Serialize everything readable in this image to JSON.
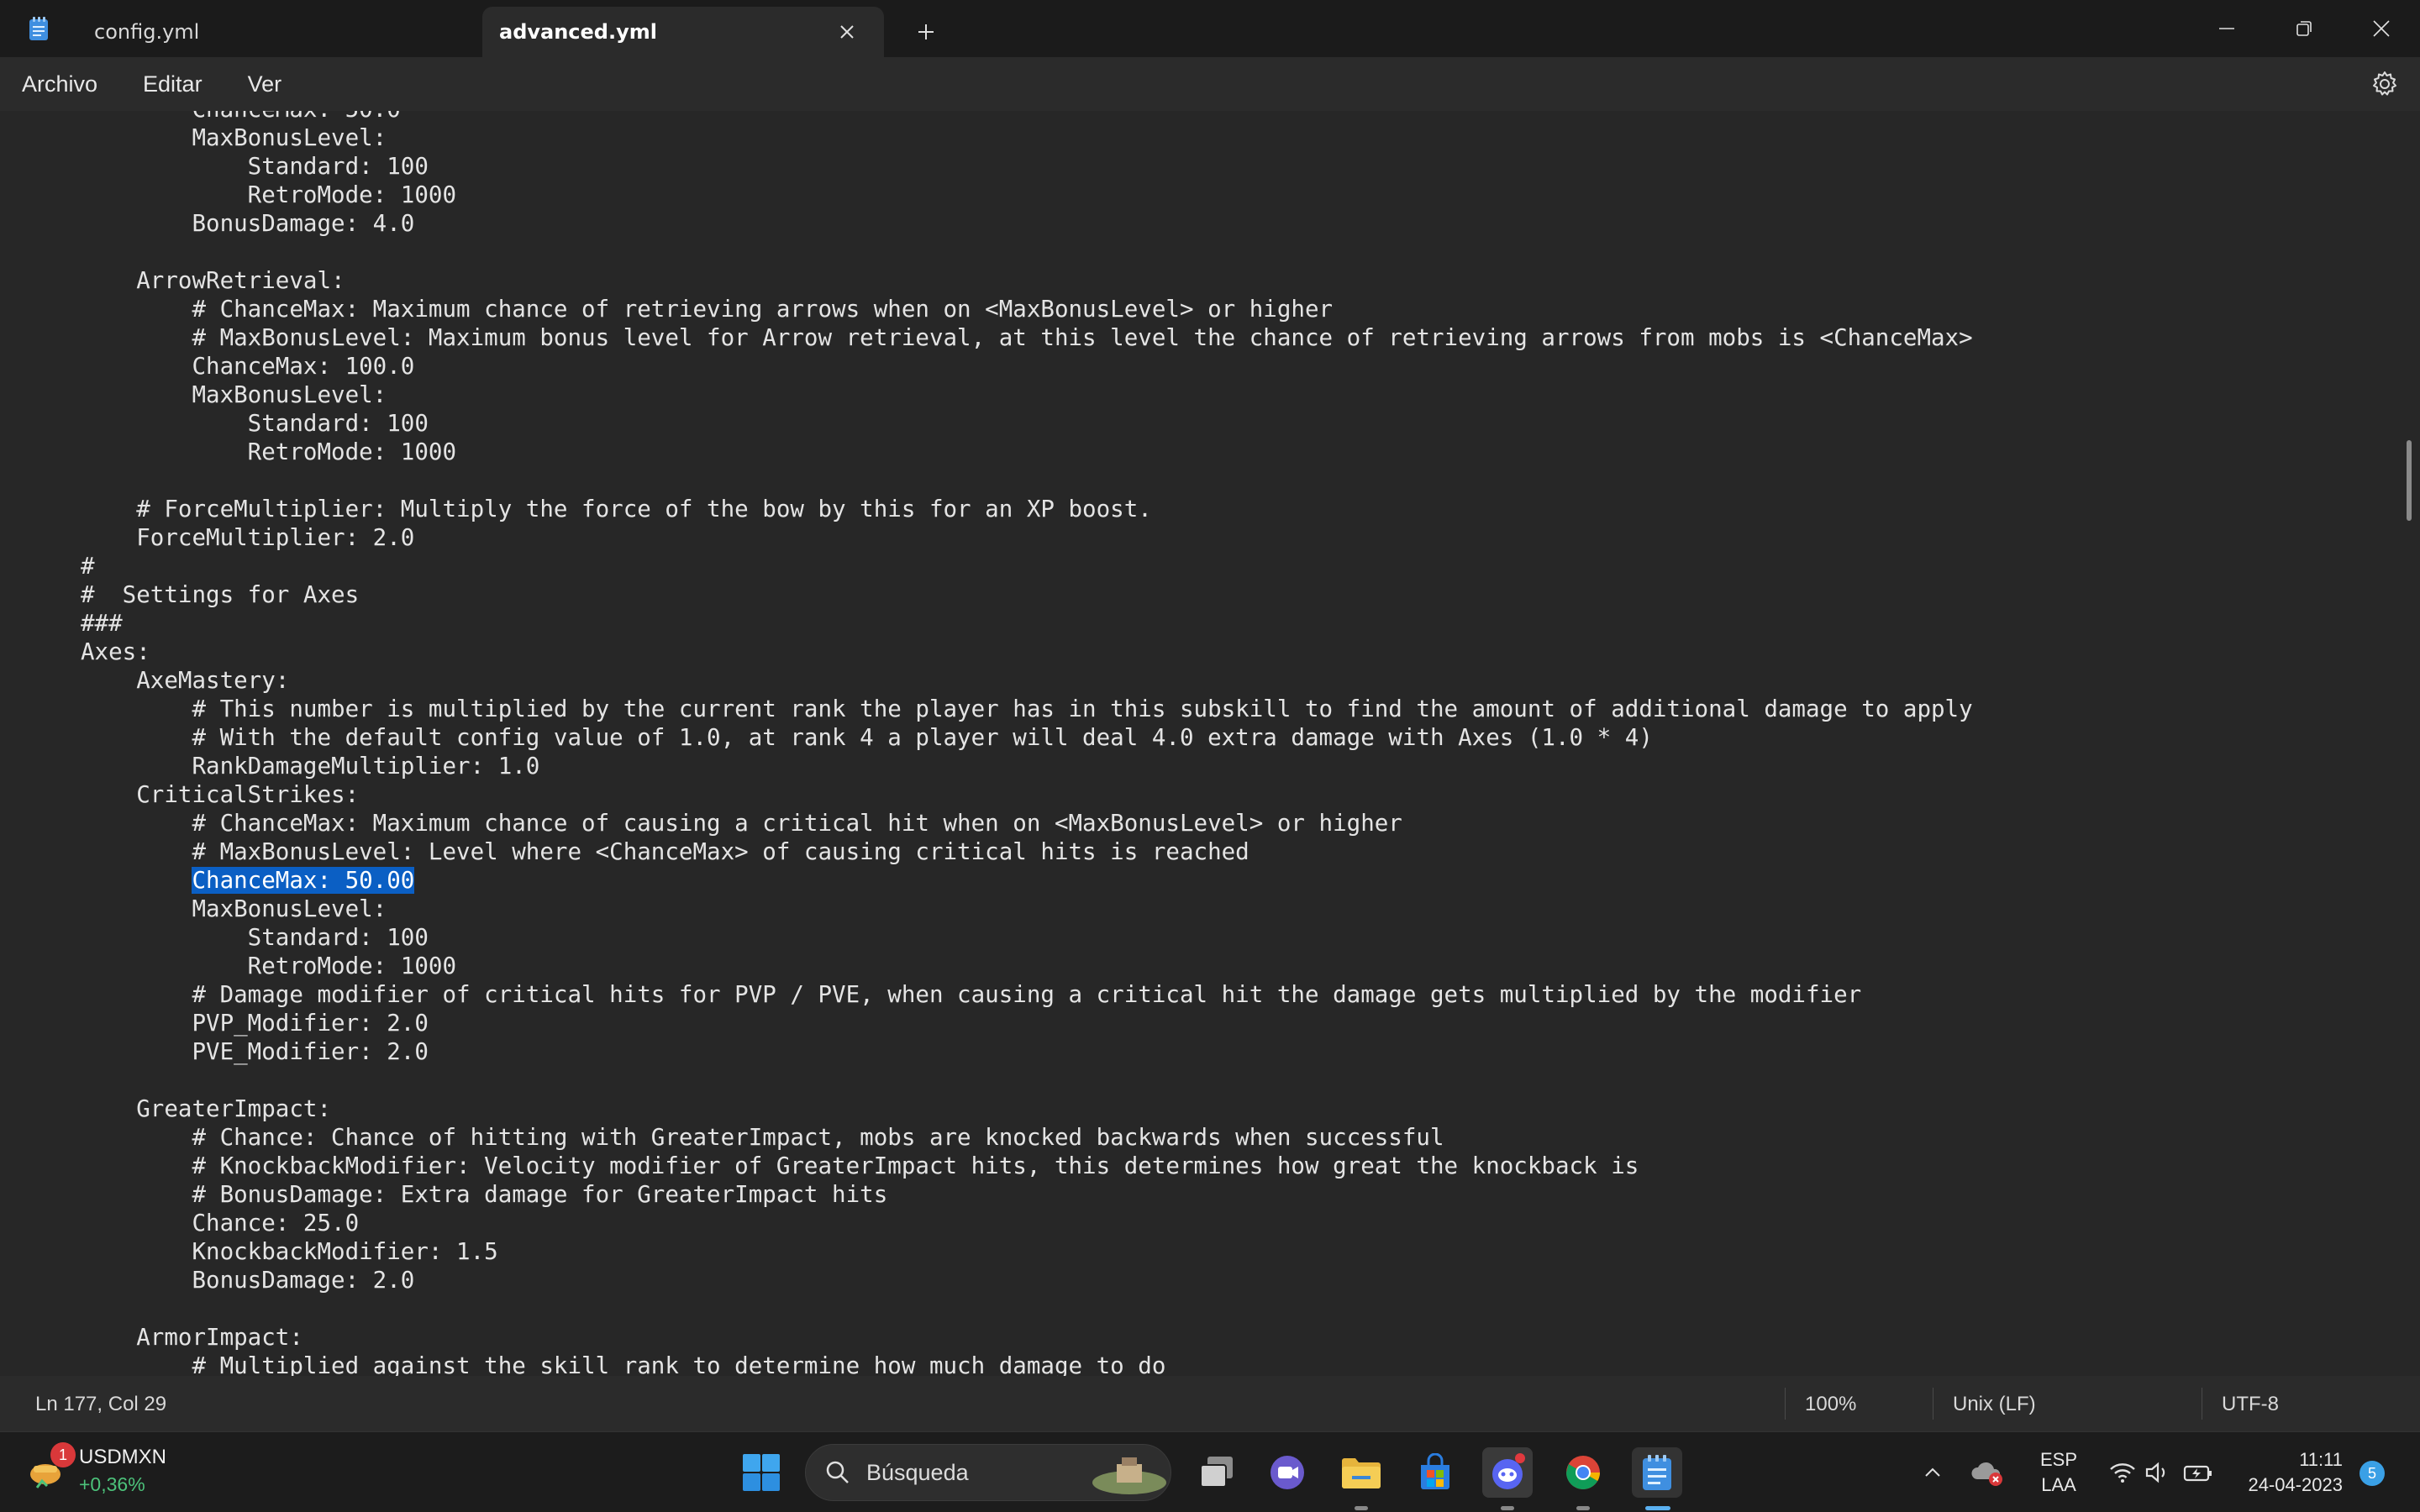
{
  "window": {
    "tabs": [
      {
        "label": "config.yml",
        "active": false
      },
      {
        "label": "advanced.yml",
        "active": true
      }
    ]
  },
  "menu": {
    "items": [
      "Archivo",
      "Editar",
      "Ver"
    ]
  },
  "editor": {
    "lines": [
      "        ChanceMax: 50.0",
      "        MaxBonusLevel:",
      "            Standard: 100",
      "            RetroMode: 1000",
      "        BonusDamage: 4.0",
      "",
      "    ArrowRetrieval:",
      "        # ChanceMax: Maximum chance of retrieving arrows when on <MaxBonusLevel> or higher",
      "        # MaxBonusLevel: Maximum bonus level for Arrow retrieval, at this level the chance of retrieving arrows from mobs is <ChanceMax>",
      "        ChanceMax: 100.0",
      "        MaxBonusLevel:",
      "            Standard: 100",
      "            RetroMode: 1000",
      "",
      "    # ForceMultiplier: Multiply the force of the bow by this for an XP boost.",
      "    ForceMultiplier: 2.0",
      "#",
      "#  Settings for Axes",
      "###",
      "Axes:",
      "    AxeMastery:",
      "        # This number is multiplied by the current rank the player has in this subskill to find the amount of additional damage to apply",
      "        # With the default config value of 1.0, at rank 4 a player will deal 4.0 extra damage with Axes (1.0 * 4)",
      "        RankDamageMultiplier: 1.0",
      "    CriticalStrikes:",
      "        # ChanceMax: Maximum chance of causing a critical hit when on <MaxBonusLevel> or higher",
      "        # MaxBonusLevel: Level where <ChanceMax> of causing critical hits is reached",
      "        ChanceMax: 50.00",
      "        MaxBonusLevel:",
      "            Standard: 100",
      "            RetroMode: 1000",
      "        # Damage modifier of critical hits for PVP / PVE, when causing a critical hit the damage gets multiplied by the modifier",
      "        PVP_Modifier: 2.0",
      "        PVE_Modifier: 2.0",
      "",
      "    GreaterImpact:",
      "        # Chance: Chance of hitting with GreaterImpact, mobs are knocked backwards when successful",
      "        # KnockbackModifier: Velocity modifier of GreaterImpact hits, this determines how great the knockback is",
      "        # BonusDamage: Extra damage for GreaterImpact hits",
      "        Chance: 25.0",
      "        KnockbackModifier: 1.5",
      "        BonusDamage: 2.0",
      "",
      "    ArmorImpact:",
      "        # Multiplied against the skill rank to determine how much damage to do"
    ],
    "selected_line": 27,
    "selected_prefix": "        ",
    "selected_text": "ChanceMax: 50.00"
  },
  "status": {
    "position": "Ln 177, Col 29",
    "zoom": "100%",
    "line_ending": "Unix (LF)",
    "encoding": "UTF-8"
  },
  "taskbar": {
    "widget_badge": "1",
    "ticker_name": "USDMXN",
    "ticker_change": "+0,36%",
    "search_placeholder": "Búsqueda",
    "lang_line1": "ESP",
    "lang_line2": "LAA",
    "time": "11:11",
    "date": "24-04-2023",
    "notification_count": "5"
  },
  "colors": {
    "selection": "#0b5fc4",
    "ticker_positive": "#4cc27a",
    "notepad_blue": "#3f8fe0"
  }
}
